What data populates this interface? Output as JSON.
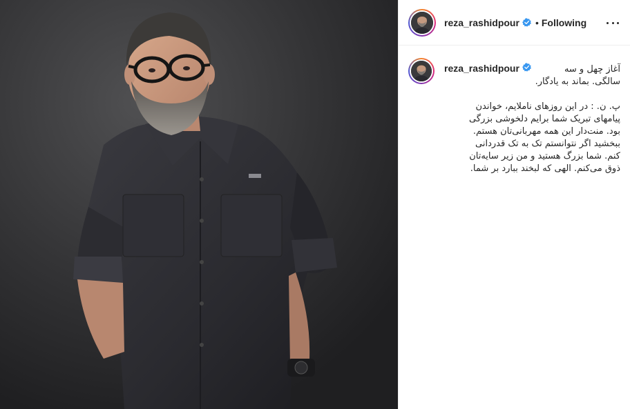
{
  "post": {
    "username": "reza_rashidpour",
    "follow_status": "Following",
    "separator": "•",
    "photo_alt": "Portrait of man in dark shirt with glasses and grey beard",
    "icons": {
      "verified": "verified-badge-icon",
      "more": "more-options-icon"
    },
    "colors": {
      "verified_blue": "#3897f0",
      "shirt": "#2e2e33",
      "background": "#333335"
    }
  },
  "caption": {
    "username": "reza_rashidpour",
    "title_line1": "آغاز چهل و سه",
    "title_line2": "سالگی. بماند به یادگار.",
    "paragraph_lines": [
      "پ. ن. : در این روزهای ناملایم، خواندن",
      "پیامهای تبریک شما برایم دلخوشی بزرگی",
      "بود. منت‌دار این همه مهربانی‌تان هستم.",
      "ببخشید اگر نتوانستم تک به تک قدردانی",
      "کنم. شما بزرگ هستید و من زیر سایه‌تان",
      "ذوق می‌کنم. الهی که لبخند ببارد بر شما."
    ]
  }
}
